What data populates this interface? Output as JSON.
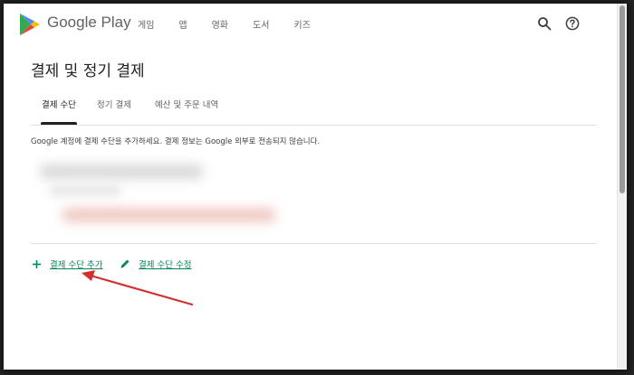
{
  "header": {
    "brand": "Google Play",
    "nav": [
      "게임",
      "앱",
      "영화",
      "도서",
      "키즈"
    ],
    "icons": [
      "search-icon",
      "help-icon"
    ]
  },
  "page": {
    "title": "결제 및 정기 결제",
    "tabs": [
      "결제 수단",
      "정기 결제",
      "예산 및 주문 내역"
    ],
    "active_tab": "결제 수단",
    "info": "Google 계정에 결제 수단을 추가하세요. 결제 정보는 Google 외부로 전송되지 않습니다."
  },
  "actions": {
    "add_label": "결제 수단 추가",
    "edit_label": "결제 수단 수정"
  },
  "colors": {
    "accent": "#01875f",
    "annotation_arrow": "#d32f2f",
    "text_primary": "#202124",
    "text_secondary": "#5f6368"
  }
}
